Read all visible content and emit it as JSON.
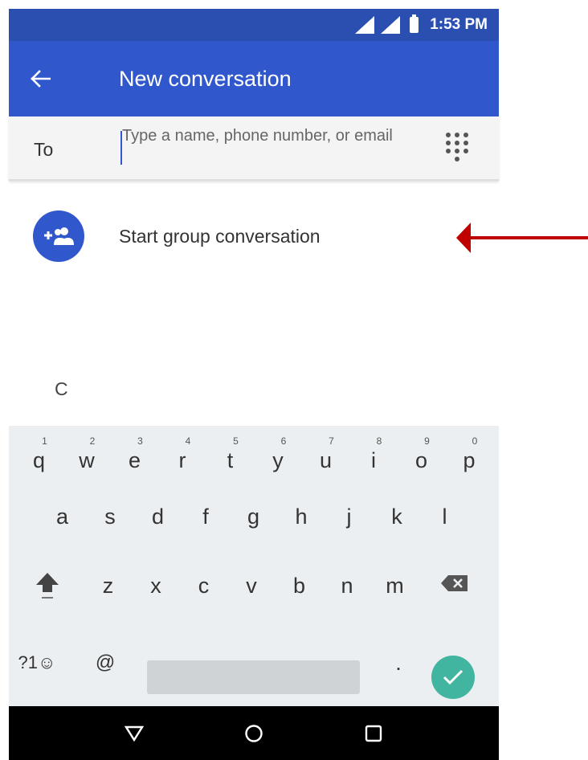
{
  "status_bar": {
    "time": "1:53 PM"
  },
  "app_bar": {
    "title": "New conversation",
    "back_icon": "arrow-back-icon"
  },
  "to_field": {
    "label": "To",
    "placeholder": "Type a name, phone number, or email",
    "value": "",
    "dialpad_icon": "dialpad-icon"
  },
  "group": {
    "label": "Start group conversation",
    "icon": "group-add-icon"
  },
  "section_header": "C",
  "keyboard": {
    "row1": [
      {
        "label": "q",
        "hint": "1"
      },
      {
        "label": "w",
        "hint": "2"
      },
      {
        "label": "e",
        "hint": "3"
      },
      {
        "label": "r",
        "hint": "4"
      },
      {
        "label": "t",
        "hint": "5"
      },
      {
        "label": "y",
        "hint": "6"
      },
      {
        "label": "u",
        "hint": "7"
      },
      {
        "label": "i",
        "hint": "8"
      },
      {
        "label": "o",
        "hint": "9"
      },
      {
        "label": "p",
        "hint": "0"
      }
    ],
    "row2": [
      "a",
      "s",
      "d",
      "f",
      "g",
      "h",
      "j",
      "k",
      "l"
    ],
    "row3": [
      "z",
      "x",
      "c",
      "v",
      "b",
      "n",
      "m"
    ],
    "symbols_label": "?1☺",
    "at_label": "@",
    "period_label": ".",
    "shift_icon": "shift-icon",
    "backspace_icon": "backspace-icon",
    "enter_icon": "check-icon"
  },
  "nav_bar": {
    "back_icon": "nav-back-icon",
    "home_icon": "nav-home-icon",
    "recents_icon": "nav-recents-icon"
  },
  "colors": {
    "status_bar": "#2a4fb0",
    "app_bar": "#3057cc",
    "accent": "#3057cc",
    "enter_key": "#41b5a0",
    "annotation_arrow": "#c00000",
    "keyboard_bg": "#eceff1"
  }
}
